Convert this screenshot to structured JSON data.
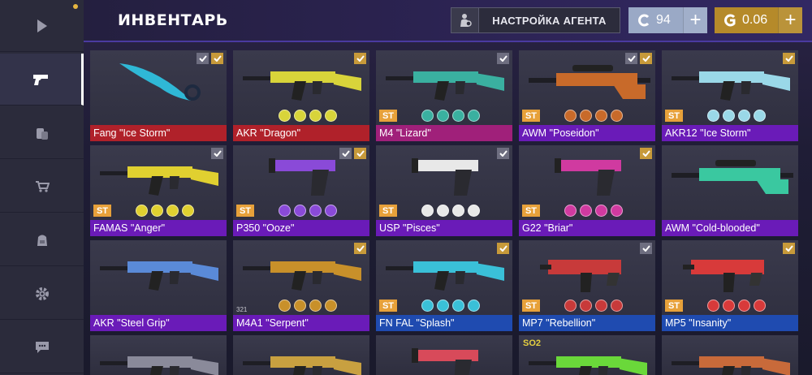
{
  "header": {
    "title": "ИНВЕНТАРЬ",
    "agent_button": "НАСТРОЙКА АГЕНТА",
    "silver": {
      "value": "94",
      "plus": "+"
    },
    "gold": {
      "value": "0.06",
      "plus": "+"
    }
  },
  "sidebar": {
    "items": [
      {
        "icon": "play-icon",
        "active": false
      },
      {
        "icon": "pistol-icon",
        "active": true
      },
      {
        "icon": "coins-icon",
        "active": false
      },
      {
        "icon": "cart-icon",
        "active": false
      },
      {
        "icon": "backpack-icon",
        "active": false
      },
      {
        "icon": "gear-icon",
        "active": false
      },
      {
        "icon": "chat-icon",
        "active": false
      }
    ]
  },
  "colors": {
    "red": "#b0212a",
    "pink": "#a0207a",
    "purple": "#6a1bb8",
    "blue": "#1f4bb0",
    "st": "#e7a13a"
  },
  "inventory": [
    {
      "name": "Fang \"Ice Storm\"",
      "rarity": "red",
      "st": false,
      "checks": [
        "grey",
        "gold"
      ],
      "stickers": 0,
      "weapon": "knife",
      "tint": "#2fb8d6"
    },
    {
      "name": "AKR \"Dragon\"",
      "rarity": "red",
      "st": false,
      "checks": [
        "gold"
      ],
      "stickers": 4,
      "weapon": "rifle",
      "tint": "#d8d43a"
    },
    {
      "name": "M4 \"Lizard\"",
      "rarity": "pink",
      "st": true,
      "checks": [
        "grey"
      ],
      "stickers": 4,
      "weapon": "rifle",
      "tint": "#3ab0a0"
    },
    {
      "name": "AWM \"Poseidon\"",
      "rarity": "purple",
      "st": true,
      "checks": [
        "grey",
        "gold"
      ],
      "stickers": 4,
      "weapon": "sniper",
      "tint": "#c86a2a"
    },
    {
      "name": "AKR12 \"Ice Storm\"",
      "rarity": "purple",
      "st": true,
      "checks": [
        "gold"
      ],
      "stickers": 4,
      "weapon": "rifle",
      "tint": "#9ad8e8"
    },
    {
      "name": "FAMAS \"Anger\"",
      "rarity": "purple",
      "st": true,
      "checks": [
        "grey"
      ],
      "stickers": 4,
      "weapon": "rifle",
      "tint": "#e0d030"
    },
    {
      "name": "P350 \"Ooze\"",
      "rarity": "purple",
      "st": true,
      "checks": [
        "grey",
        "gold"
      ],
      "stickers": 4,
      "weapon": "pistol",
      "tint": "#8a4ad8"
    },
    {
      "name": "USP \"Pisces\"",
      "rarity": "purple",
      "st": true,
      "checks": [
        "grey"
      ],
      "stickers": 4,
      "weapon": "pistol",
      "tint": "#e8e8e8"
    },
    {
      "name": "G22 \"Briar\"",
      "rarity": "purple",
      "st": true,
      "checks": [
        "gold"
      ],
      "stickers": 4,
      "weapon": "pistol",
      "tint": "#d03aa0"
    },
    {
      "name": "AWM \"Cold-blooded\"",
      "rarity": "purple",
      "st": false,
      "checks": [],
      "stickers": 0,
      "weapon": "sniper",
      "tint": "#3ac8a0"
    },
    {
      "name": "AKR \"Steel Grip\"",
      "rarity": "purple",
      "st": false,
      "checks": [],
      "stickers": 0,
      "weapon": "rifle",
      "tint": "#5a8ad8"
    },
    {
      "name": "M4A1 \"Serpent\"",
      "rarity": "purple",
      "st": false,
      "checks": [
        "gold"
      ],
      "stickers": 4,
      "weapon": "rifle",
      "tint": "#c8902a",
      "counter": "321"
    },
    {
      "name": "FN FAL \"Splash\"",
      "rarity": "blue",
      "st": true,
      "checks": [
        "gold"
      ],
      "stickers": 4,
      "weapon": "rifle",
      "tint": "#3ac0d8"
    },
    {
      "name": "MP7 \"Rebellion\"",
      "rarity": "blue",
      "st": true,
      "checks": [
        "grey"
      ],
      "stickers": 4,
      "weapon": "smg",
      "tint": "#c83a3a"
    },
    {
      "name": "MP5 \"Insanity\"",
      "rarity": "blue",
      "st": true,
      "checks": [
        "gold"
      ],
      "stickers": 4,
      "weapon": "smg",
      "tint": "#d83a3a"
    },
    {
      "name": "",
      "rarity": "none",
      "st": false,
      "checks": [],
      "stickers": 0,
      "weapon": "rifle",
      "tint": "#8a8a9a"
    },
    {
      "name": "",
      "rarity": "none",
      "st": false,
      "checks": [],
      "stickers": 0,
      "weapon": "rifle",
      "tint": "#c8a040"
    },
    {
      "name": "",
      "rarity": "none",
      "st": false,
      "checks": [],
      "stickers": 0,
      "weapon": "pistol",
      "tint": "#d84a5a"
    },
    {
      "name": "",
      "rarity": "none",
      "st": false,
      "checks": [],
      "stickers": 0,
      "weapon": "rifle",
      "tint": "#6ad83a",
      "tag": "SO2"
    },
    {
      "name": "",
      "rarity": "none",
      "st": false,
      "checks": [],
      "stickers": 0,
      "weapon": "rifle",
      "tint": "#c86a3a"
    }
  ]
}
